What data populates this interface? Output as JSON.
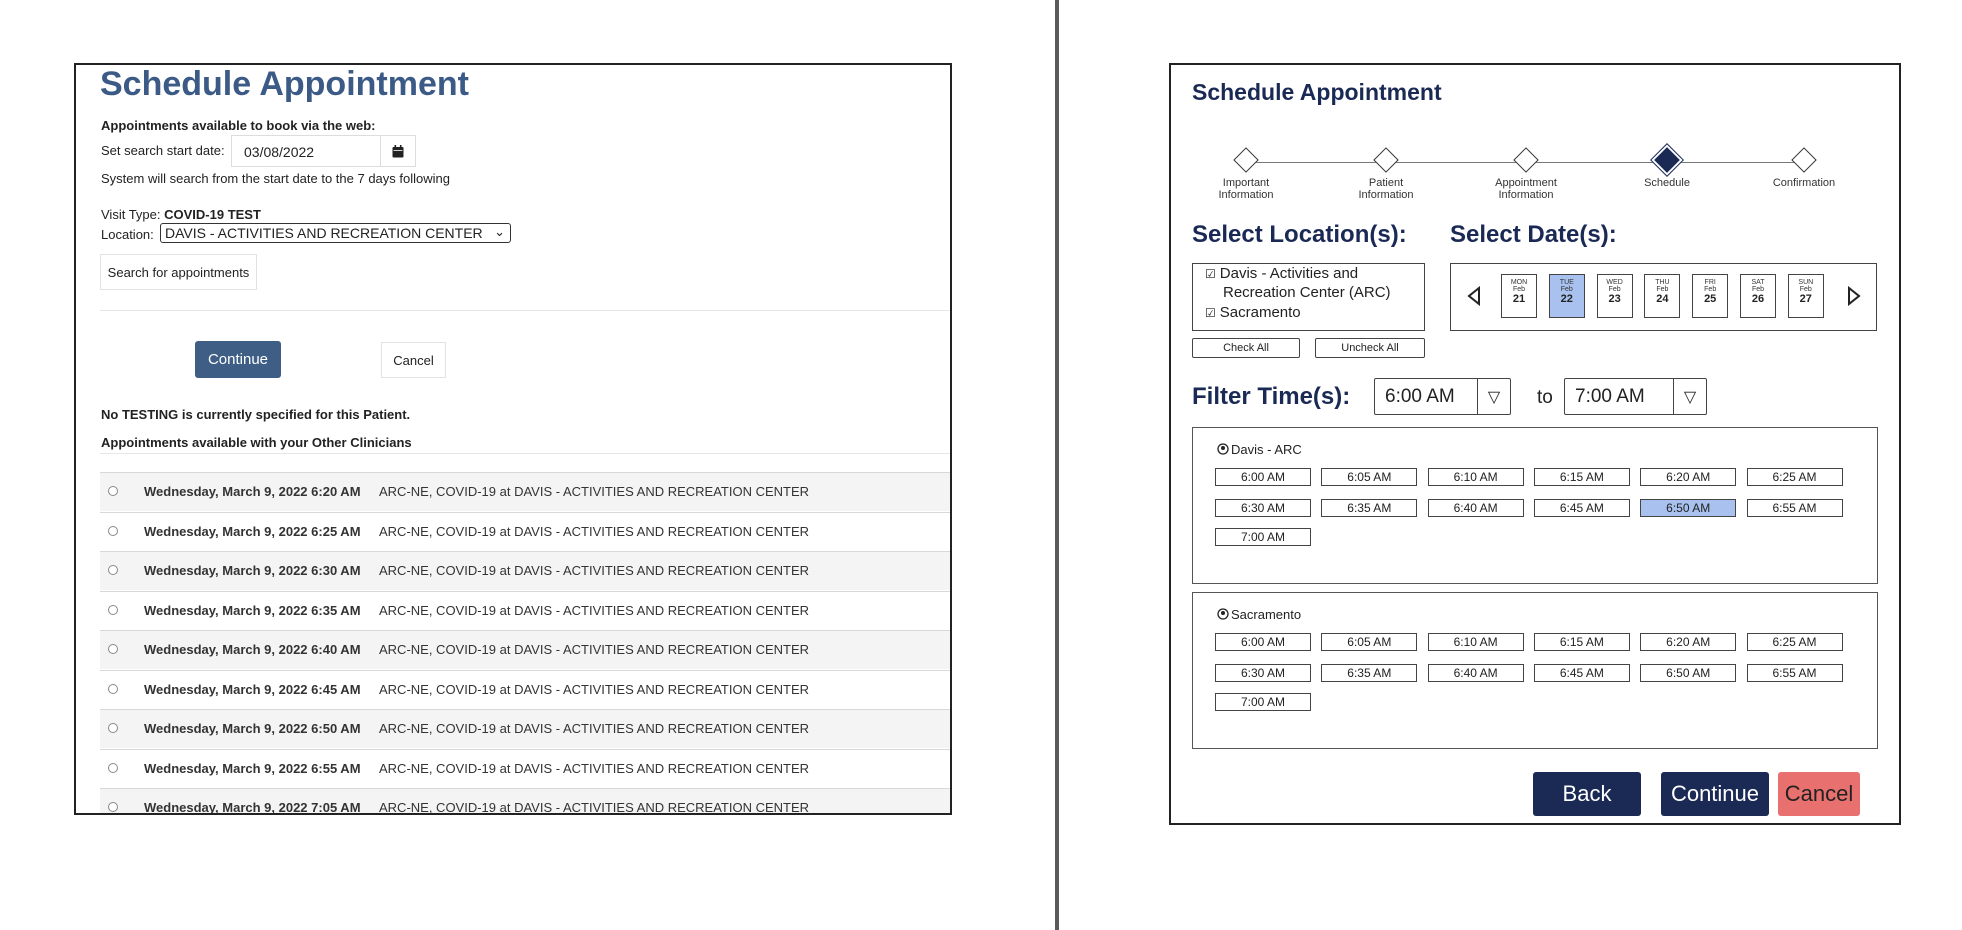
{
  "left": {
    "title": "Schedule Appointment",
    "available_heading": "Appointments available to book via the web:",
    "start_date_label": "Set search start date:",
    "start_date_value": "03/08/2022",
    "search_note": "System will search from the start date to the 7 days following",
    "visit_type_label": "Visit Type:",
    "visit_type_value": "COVID-19 TEST",
    "location_label": "Location:",
    "location_value": "DAVIS - ACTIVITIES AND RECREATION CENTER",
    "search_button": "Search for appointments",
    "continue_button": "Continue",
    "cancel_button": "Cancel",
    "no_testing_note": "No TESTING is currently specified for this Patient.",
    "other_clinicians_heading": "Appointments available with your Other Clinicians",
    "appointments": [
      {
        "when": "Wednesday, March 9, 2022 6:20 AM",
        "where": "ARC-NE, COVID-19 at DAVIS - ACTIVITIES AND RECREATION CENTER"
      },
      {
        "when": "Wednesday, March 9, 2022 6:25 AM",
        "where": "ARC-NE, COVID-19 at DAVIS - ACTIVITIES AND RECREATION CENTER"
      },
      {
        "when": "Wednesday, March 9, 2022 6:30 AM",
        "where": "ARC-NE, COVID-19 at DAVIS - ACTIVITIES AND RECREATION CENTER"
      },
      {
        "when": "Wednesday, March 9, 2022 6:35 AM",
        "where": "ARC-NE, COVID-19 at DAVIS - ACTIVITIES AND RECREATION CENTER"
      },
      {
        "when": "Wednesday, March 9, 2022 6:40 AM",
        "where": "ARC-NE, COVID-19 at DAVIS - ACTIVITIES AND RECREATION CENTER"
      },
      {
        "when": "Wednesday, March 9, 2022 6:45 AM",
        "where": "ARC-NE, COVID-19 at DAVIS - ACTIVITIES AND RECREATION CENTER"
      },
      {
        "when": "Wednesday, March 9, 2022 6:50 AM",
        "where": "ARC-NE, COVID-19 at DAVIS - ACTIVITIES AND RECREATION CENTER"
      },
      {
        "when": "Wednesday, March 9, 2022 6:55 AM",
        "where": "ARC-NE, COVID-19 at DAVIS - ACTIVITIES AND RECREATION CENTER"
      },
      {
        "when": "Wednesday, March 9, 2022 7:05 AM",
        "where": "ARC-NE, COVID-19 at DAVIS - ACTIVITIES AND RECREATION CENTER"
      }
    ]
  },
  "right": {
    "title": "Schedule Appointment",
    "steps": [
      {
        "label_line1": "Important",
        "label_line2": "Information",
        "active": false
      },
      {
        "label_line1": "Patient",
        "label_line2": "Information",
        "active": false
      },
      {
        "label_line1": "Appointment",
        "label_line2": "Information",
        "active": false
      },
      {
        "label_line1": "Schedule",
        "label_line2": "",
        "active": true
      },
      {
        "label_line1": "Confirmation",
        "label_line2": "",
        "active": false
      }
    ],
    "select_locations_heading": "Select Location(s):",
    "select_dates_heading": "Select Date(s):",
    "locations": [
      {
        "line1": "Davis - Activities and",
        "line2": "Recreation Center (ARC)",
        "checked": true
      },
      {
        "line1": "Sacramento",
        "line2": "",
        "checked": true
      }
    ],
    "check_all_button": "Check All",
    "uncheck_all_button": "Uncheck All",
    "days": [
      {
        "dow": "MON",
        "month": "Feb",
        "date": "21",
        "selected": false
      },
      {
        "dow": "TUE",
        "month": "Feb",
        "date": "22",
        "selected": true
      },
      {
        "dow": "WED",
        "month": "Feb",
        "date": "23",
        "selected": false
      },
      {
        "dow": "THU",
        "month": "Feb",
        "date": "24",
        "selected": false
      },
      {
        "dow": "FRI",
        "month": "Feb",
        "date": "25",
        "selected": false
      },
      {
        "dow": "SAT",
        "month": "Feb",
        "date": "26",
        "selected": false
      },
      {
        "dow": "SUN",
        "month": "Feb",
        "date": "27",
        "selected": false
      }
    ],
    "filter_heading": "Filter Time(s):",
    "from_time": "6:00 AM",
    "to_label": "to",
    "to_time": "7:00 AM",
    "groups": [
      {
        "name": "Davis - ARC",
        "slots": [
          "6:00 AM",
          "6:05 AM",
          "6:10 AM",
          "6:15 AM",
          "6:20 AM",
          "6:25 AM",
          "6:30 AM",
          "6:35 AM",
          "6:40 AM",
          "6:45 AM",
          "6:50 AM",
          "6:55 AM",
          "7:00 AM"
        ],
        "selected_slot": "6:50 AM"
      },
      {
        "name": "Sacramento",
        "slots": [
          "6:00 AM",
          "6:05 AM",
          "6:10 AM",
          "6:15 AM",
          "6:20 AM",
          "6:25 AM",
          "6:30 AM",
          "6:35 AM",
          "6:40 AM",
          "6:45 AM",
          "6:50 AM",
          "6:55 AM",
          "7:00 AM"
        ],
        "selected_slot": ""
      }
    ],
    "back_button": "Back",
    "continue_button": "Continue",
    "cancel_button": "Cancel",
    "colors": {
      "navy": "#1a2a55",
      "selected": "#a8c1ee",
      "cancel": "#e8706f",
      "left_accent": "#3f5e86"
    }
  }
}
